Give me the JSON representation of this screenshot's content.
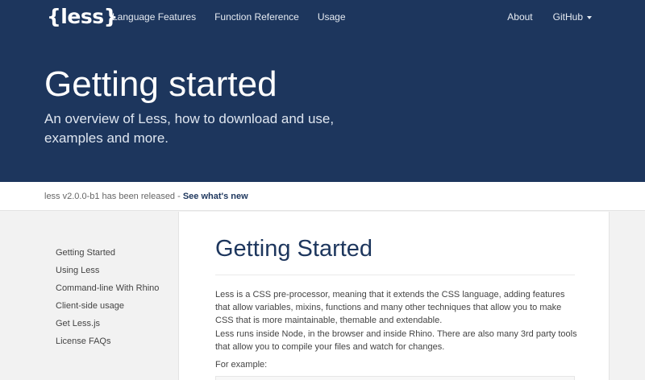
{
  "navbar": {
    "logo": "{less}",
    "left_links": [
      "Language Features",
      "Function Reference",
      "Usage"
    ],
    "right_links": [
      "About",
      "GitHub"
    ]
  },
  "hero": {
    "title": "Getting started",
    "subtitle": "An overview of Less, how to download and use, examples and more."
  },
  "release": {
    "text": "less v2.0.0-b1 has been released - ",
    "link": "See what's new"
  },
  "sidebar": {
    "items": [
      "Getting Started",
      "Using Less",
      "Command-line With Rhino",
      "Client-side usage",
      "Get Less.js",
      "License FAQs"
    ]
  },
  "content": {
    "title": "Getting Started",
    "paragraphs": [
      "Less is a CSS pre-processor, meaning that it extends the CSS language, adding features that allow variables, mixins, functions and many other techniques that allow you to make CSS that is more maintainable, themable and extendable.",
      "Less runs inside Node, in the browser and inside Rhino. There are also many 3rd party tools that allow you to compile your files and watch for changes.",
      "For example:"
    ]
  },
  "colors": {
    "header_bg": "#1d365d",
    "page_bg": "#f2f2f2"
  }
}
